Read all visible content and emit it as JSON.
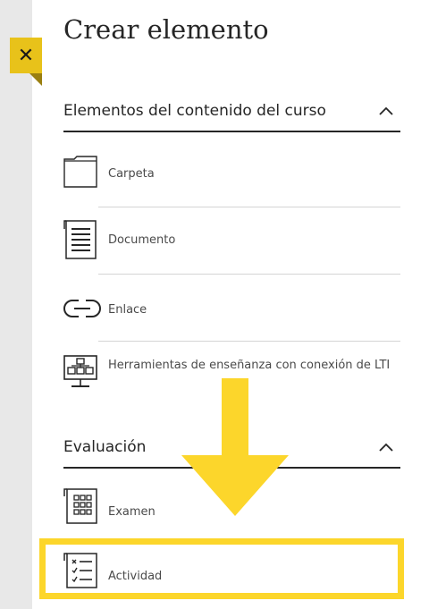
{
  "panel": {
    "title": "Crear elemento",
    "close_glyph": "✕"
  },
  "sections": [
    {
      "label": "Elementos del contenido del curso",
      "items": [
        {
          "label": "Carpeta",
          "icon": "folder-icon"
        },
        {
          "label": "Documento",
          "icon": "document-icon"
        },
        {
          "label": "Enlace",
          "icon": "link-icon"
        },
        {
          "label": "Herramientas de enseñanza con conexión de LTI",
          "icon": "lti-tool-icon"
        }
      ]
    },
    {
      "label": "Evaluación",
      "items": [
        {
          "label": "Examen",
          "icon": "exam-icon"
        },
        {
          "label": "Actividad",
          "icon": "assignment-icon"
        }
      ]
    }
  ],
  "colors": {
    "accent_yellow": "#fcd62b",
    "close_tab": "#e8c21a",
    "text": "#262626",
    "sidebar": "#e8e8e8"
  }
}
